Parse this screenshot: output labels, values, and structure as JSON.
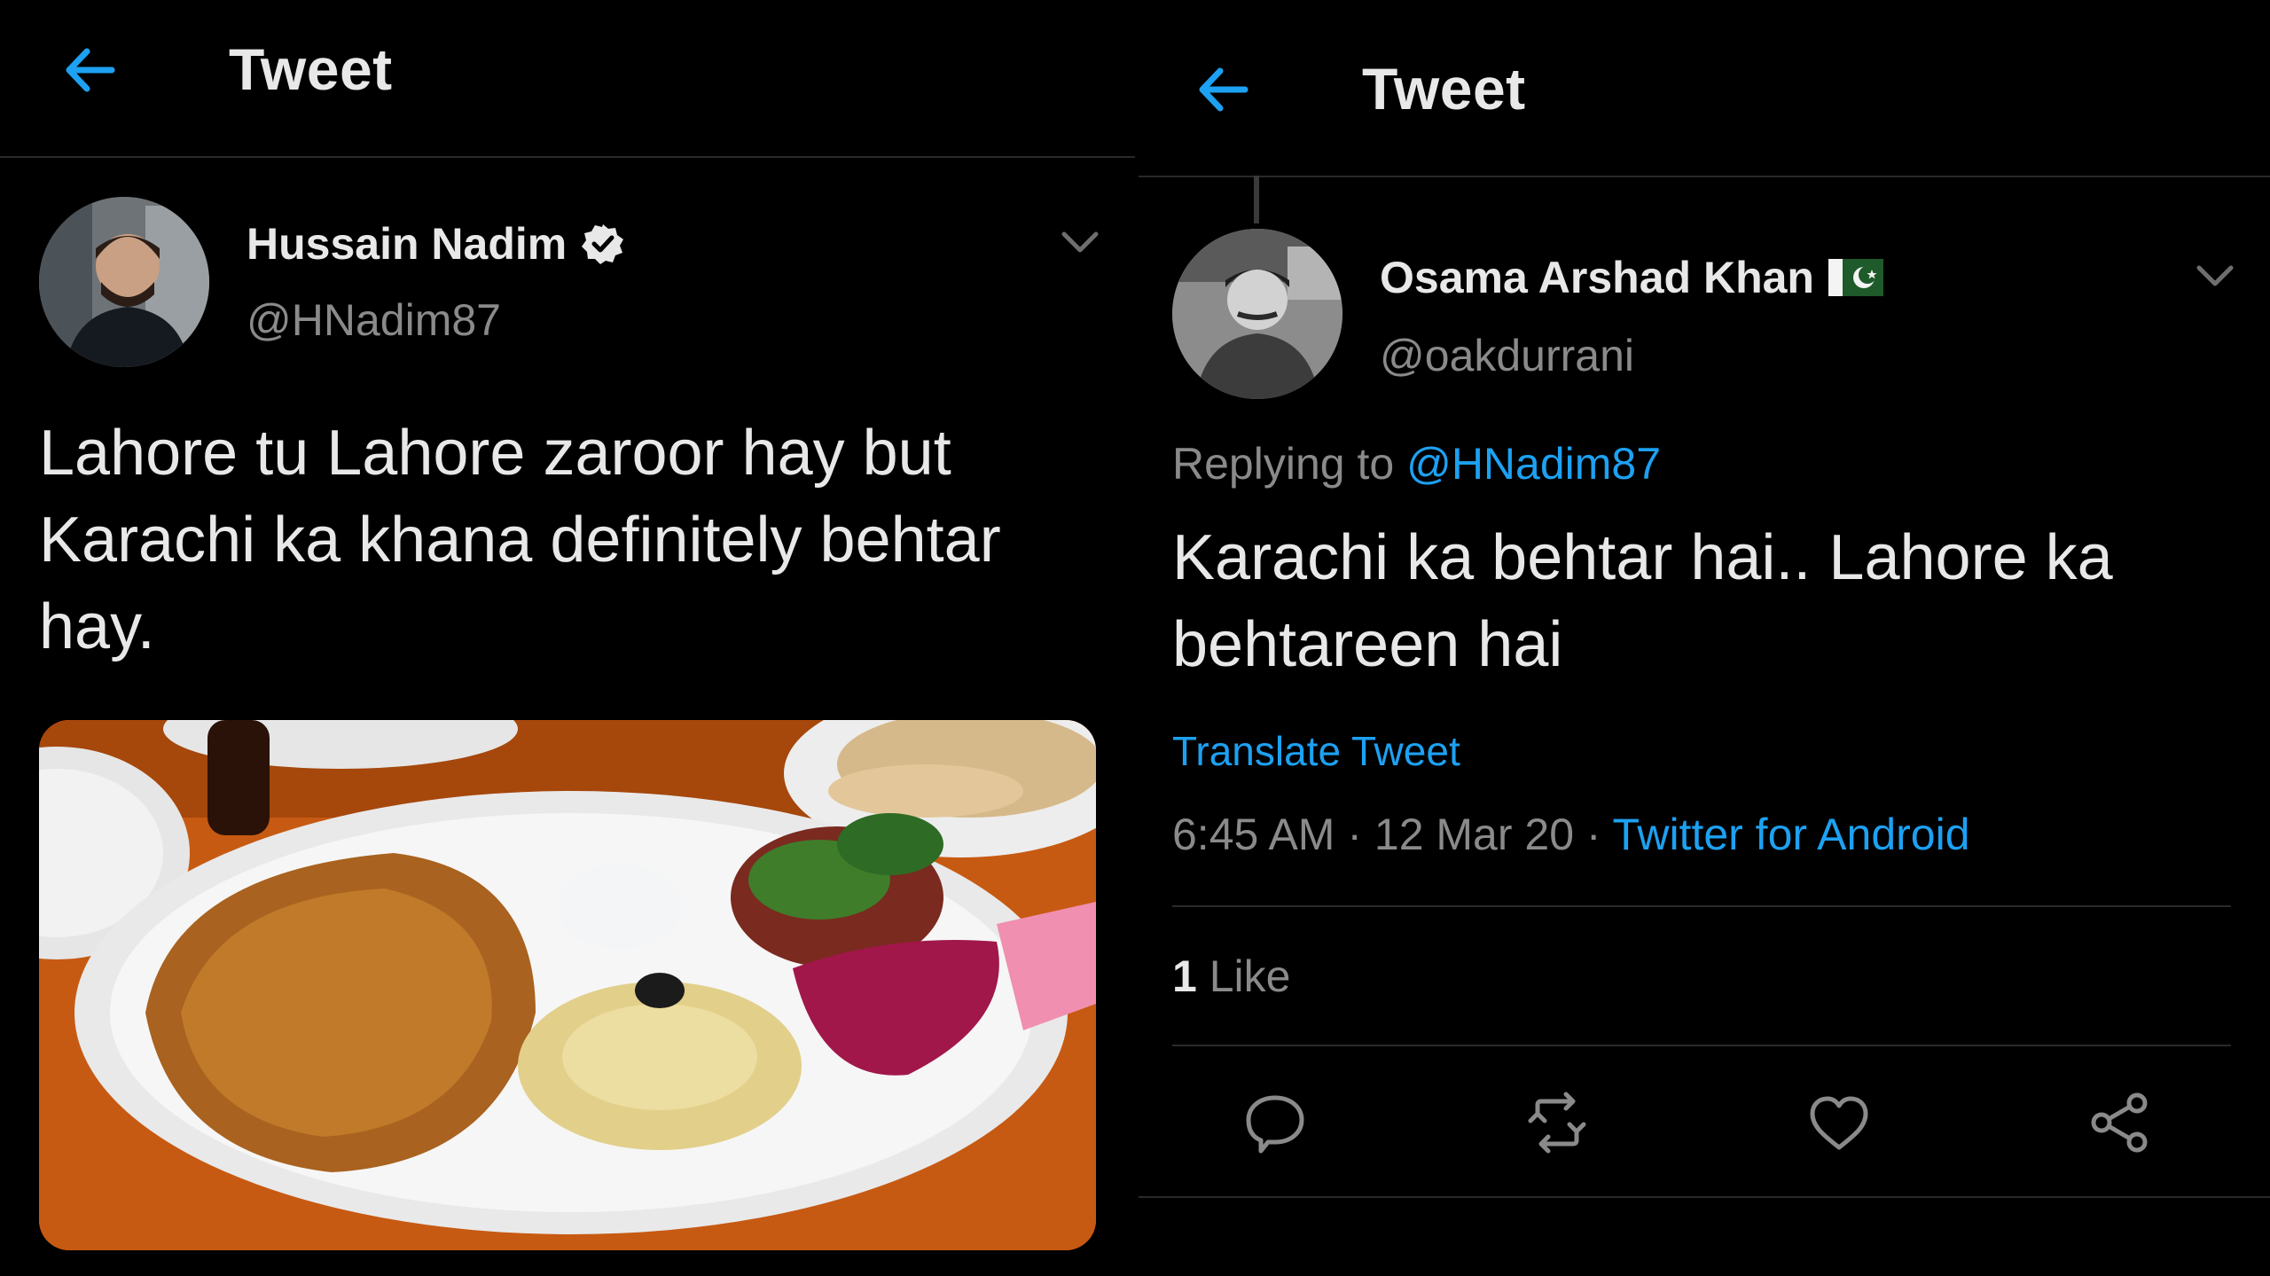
{
  "left": {
    "header": {
      "title": "Tweet"
    },
    "author": {
      "name": "Hussain Nadim",
      "handle": "@HNadim87"
    },
    "tweet_text": "Lahore tu Lahore zaroor hay but Karachi ka khana definitely behtar hay."
  },
  "right": {
    "header": {
      "title": "Tweet"
    },
    "author": {
      "name": "Osama Arshad Khan",
      "handle": "@oakdurrani"
    },
    "replying_prefix": "Replying to",
    "replying_mention": "@HNadim87",
    "tweet_text": "Karachi ka behtar hai.. Lahore ka behtareen hai",
    "translate_label": "Translate Tweet",
    "time": "6:45 AM",
    "separator1": " · ",
    "date": "12 Mar 20",
    "separator2": " · ",
    "source": "Twitter for Android",
    "likes_count": "1",
    "likes_label": "Like"
  },
  "colors": {
    "background": "#000000",
    "accent": "#1da1f2",
    "text_primary": "#e8e8e8",
    "text_secondary": "#8a8a8a",
    "divider": "#2a2a2a"
  },
  "icons": {
    "back": "arrow-left-icon",
    "verified": "verified-badge-icon",
    "flag": "pakistan-flag-icon",
    "more": "chevron-down-icon",
    "reply": "reply-icon",
    "retweet": "retweet-icon",
    "like": "heart-icon",
    "share": "share-icon"
  }
}
